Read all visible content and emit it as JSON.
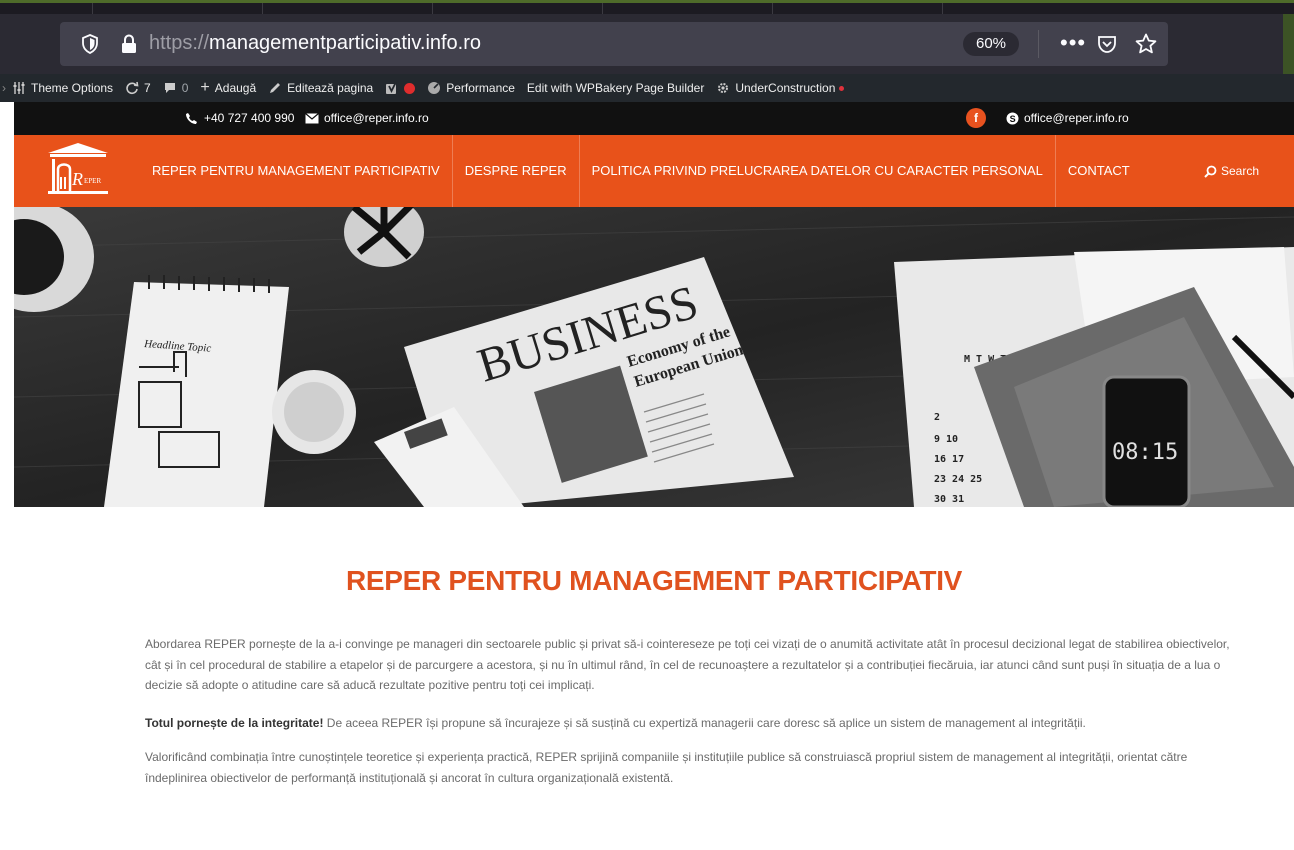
{
  "browser": {
    "url_protocol": "https://",
    "url_domain": "managementparticipativ.info.ro",
    "zoom": "60%",
    "menu_dots": "•••"
  },
  "admin_bar": {
    "theme_options": "Theme Options",
    "updates_count": "7",
    "comments_count": "0",
    "add_new": "Adaugă",
    "edit_page": "Editează pagina",
    "performance": "Performance",
    "wpbakery": "Edit with WPBakery Page Builder",
    "under_construction": "UnderConstruction"
  },
  "topbar": {
    "phone": "+40 727 400 990",
    "email": "office@reper.info.ro",
    "facebook_letter": "f",
    "skype_email": "office@reper.info.ro"
  },
  "nav": {
    "items": [
      "REPER PENTRU MANAGEMENT PARTICIPATIV",
      "DESPRE REPER",
      "POLITICA PRIVIND PRELUCRAREA DATELOR CU CARACTER PERSONAL",
      "CONTACT"
    ],
    "search_label": "Search",
    "logo_text": "REPER"
  },
  "hero": {
    "newspaper_word": "BUSINESS",
    "newspaper_headline_1": "Economy of the",
    "newspaper_headline_2": "European Union",
    "phone_time": "08:15",
    "notebook_text": "Headline Topic",
    "calendar_header": "M  T  W  T",
    "calendar_rows": [
      "2",
      "9   10",
      "16   17",
      "23   24   25",
      "30   31"
    ]
  },
  "content": {
    "title": "REPER PENTRU MANAGEMENT PARTICIPATIV",
    "para1": "Abordarea REPER pornește de la a-i convinge pe manageri  din sectoarele public și privat să-i cointereseze pe toți cei vizați de o anumită activitate atât în procesul decizional legat de stabilirea obiectivelor, cât și în cel procedural de stabilire a etapelor și de parcurgere a acestora, și nu în ultimul rând, în cel de recunoaștere a rezultatelor și a contribuției fiecăruia, iar atunci când sunt puși în situația de a lua o decizie să adopte o atitudine care să aducă rezultate pozitive pentru toți cei implicați.",
    "para2_bold": "Totul pornește de la integritate!",
    "para2_rest": " De aceea REPER își propune să încurajeze și să susțină cu expertiză managerii care doresc să aplice un sistem de management al integrității.",
    "para3": "Valorificând combinația între cunoștințele teoretice și experiența practică, REPER sprijină companiile și instituțiile publice să construiască propriul sistem de management al integrității, orientat către îndeplinirea obiectivelor de performanță instituțională și ancorat în cultura organizațională existentă."
  },
  "colors": {
    "brand_orange": "#e8521a",
    "title_orange": "#e0521f",
    "browser_bg": "#2b2a33",
    "admin_bg": "#23282d"
  }
}
